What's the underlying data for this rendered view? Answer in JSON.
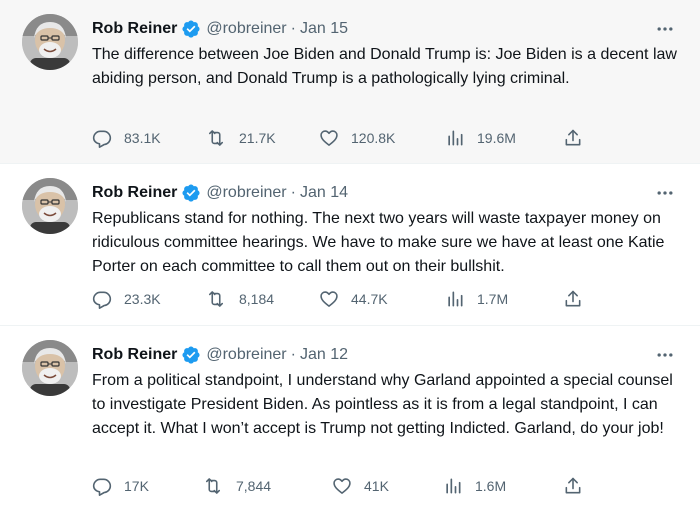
{
  "tweets": [
    {
      "author": {
        "name": "Rob Reiner",
        "handle": "@robreiner",
        "verified": true
      },
      "date": "Jan 15",
      "text": "The difference between Joe Biden and Donald Trump is: Joe Biden is a decent law abiding person, and Donald Trump is a pathologically lying criminal.",
      "stats": {
        "replies": "83.1K",
        "retweets": "21.7K",
        "likes": "120.8K",
        "views": "19.6M"
      }
    },
    {
      "author": {
        "name": "Rob Reiner",
        "handle": "@robreiner",
        "verified": true
      },
      "date": "Jan 14",
      "text": "Republicans stand for nothing. The next two years will waste taxpayer money on ridiculous committee hearings. We have to make sure we have at least one Katie Porter on each committee to call them out on their bullshit.",
      "stats": {
        "replies": "23.3K",
        "retweets": "8,184",
        "likes": "44.7K",
        "views": "1.7M"
      }
    },
    {
      "author": {
        "name": "Rob Reiner",
        "handle": "@robreiner",
        "verified": true
      },
      "date": "Jan 12",
      "text": "From a political standpoint, I understand why Garland appointed a special counsel to investigate President Biden. As pointless as it is from a legal standpoint, I can accept it. What I won’t accept is Trump not getting Indicted. Garland, do your job!",
      "stats": {
        "replies": "17K",
        "retweets": "7,844",
        "likes": "41K",
        "views": "1.6M"
      }
    }
  ],
  "separator": "·",
  "icons": {
    "reply": "reply-icon",
    "retweet": "retweet-icon",
    "like": "heart-icon",
    "views": "views-icon",
    "share": "share-icon",
    "more": "more-icon",
    "verified": "verified-badge-icon"
  },
  "colors": {
    "text": "#0f1419",
    "muted": "#536471",
    "verified": "#1d9bf0",
    "highlight_bg": "#f7f7f7"
  }
}
